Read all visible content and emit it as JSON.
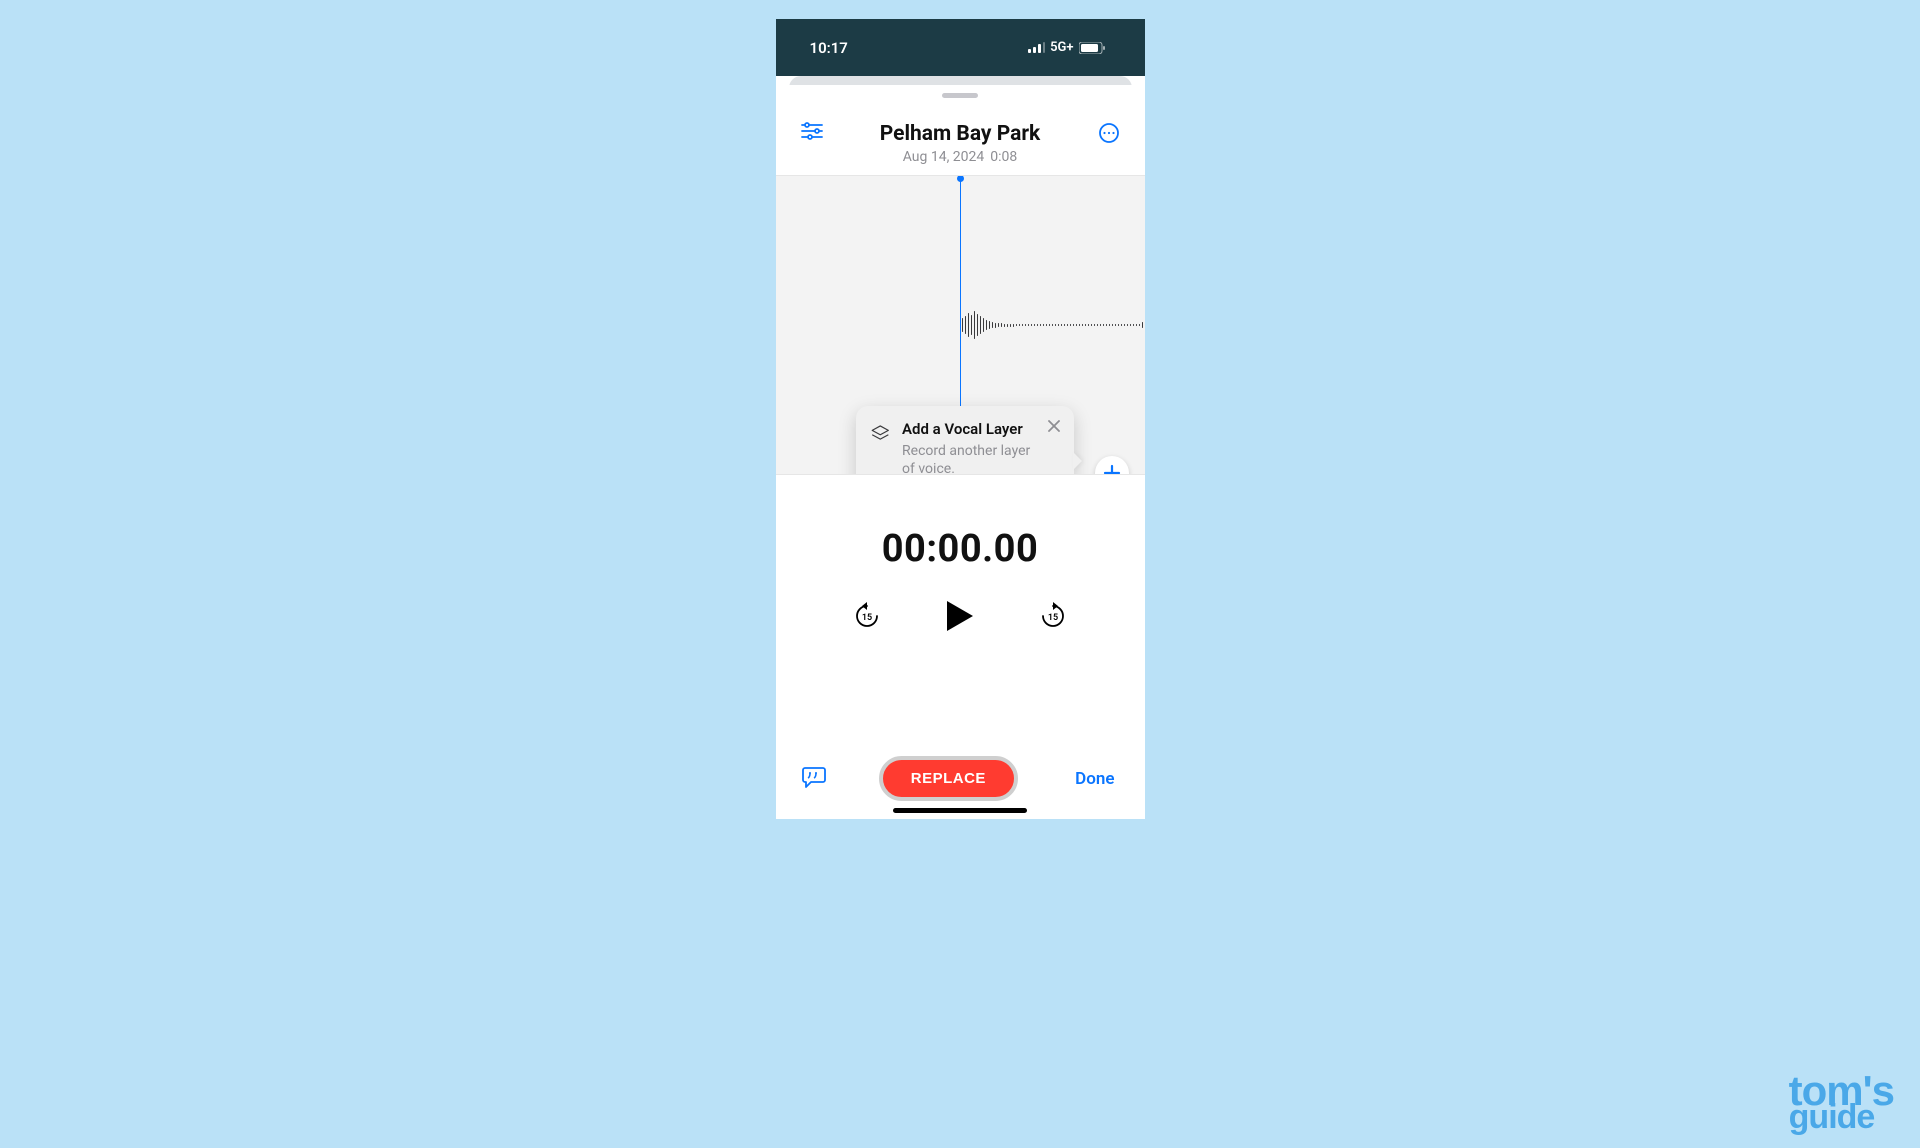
{
  "status": {
    "time": "10:17",
    "network": "5G+"
  },
  "recording": {
    "title": "Pelham Bay Park",
    "date": "Aug 14, 2024",
    "length": "0:08",
    "timecode": "00:00.00"
  },
  "tooltip": {
    "title": "Add a Vocal Layer",
    "body": "Record another layer of voice."
  },
  "transport": {
    "skip_seconds": "15"
  },
  "buttons": {
    "replace": "REPLACE",
    "done": "Done"
  },
  "watermark": {
    "line1": "tom's",
    "line2": "guide"
  },
  "colors": {
    "accent": "#0a75ff",
    "destructive": "#ff3b30"
  }
}
